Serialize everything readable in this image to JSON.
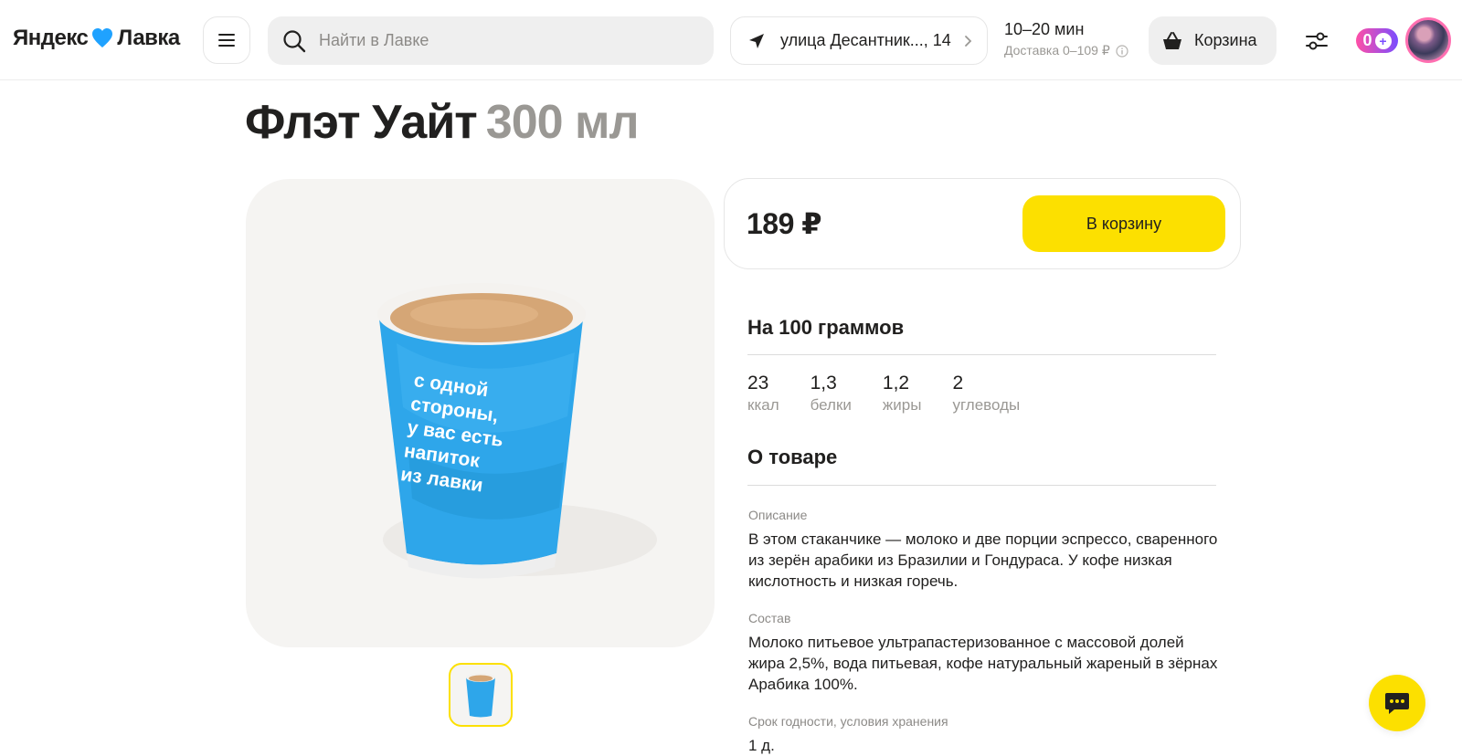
{
  "header": {
    "brand_left": "Яндекс",
    "brand_right": "Лавка",
    "search_placeholder": "Найти в Лавке",
    "address": "улица Десантник..., 14",
    "delivery_time": "10–20 мин",
    "delivery_cost": "Доставка 0–109 ₽",
    "cart_label": "Корзина",
    "plus_points": "0",
    "colors": {
      "accent": "#fce000",
      "brand_heart": "#1fa2ff"
    }
  },
  "product": {
    "name": "Флэт Уайт",
    "volume": "300 мл",
    "price": "189 ₽",
    "add_to_cart": "В корзину",
    "cup_text": [
      "с одной",
      "стороны,",
      "у вас есть",
      "напиток",
      "из лавки"
    ]
  },
  "nutrition": {
    "heading": "На 100 граммов",
    "items": [
      {
        "value": "23",
        "label": "ккал"
      },
      {
        "value": "1,3",
        "label": "белки"
      },
      {
        "value": "1,2",
        "label": "жиры"
      },
      {
        "value": "2",
        "label": "углеводы"
      }
    ]
  },
  "about": {
    "heading": "О товаре",
    "description_label": "Описание",
    "description": "В этом стаканчике — молоко и две порции эспрессо, сваренного из зерён арабики из Бразилии и Гондураса. У кофе низкая кислотность и низкая горечь.",
    "composition_label": "Состав",
    "composition": "Молоко питьевое ультрапастеризованное с массовой долей жира 2,5%, вода питьевая, кофе натуральный жареный в зёрнах Арабика 100%.",
    "shelf_label": "Срок годности, условия хранения",
    "shelf": "1 д."
  }
}
